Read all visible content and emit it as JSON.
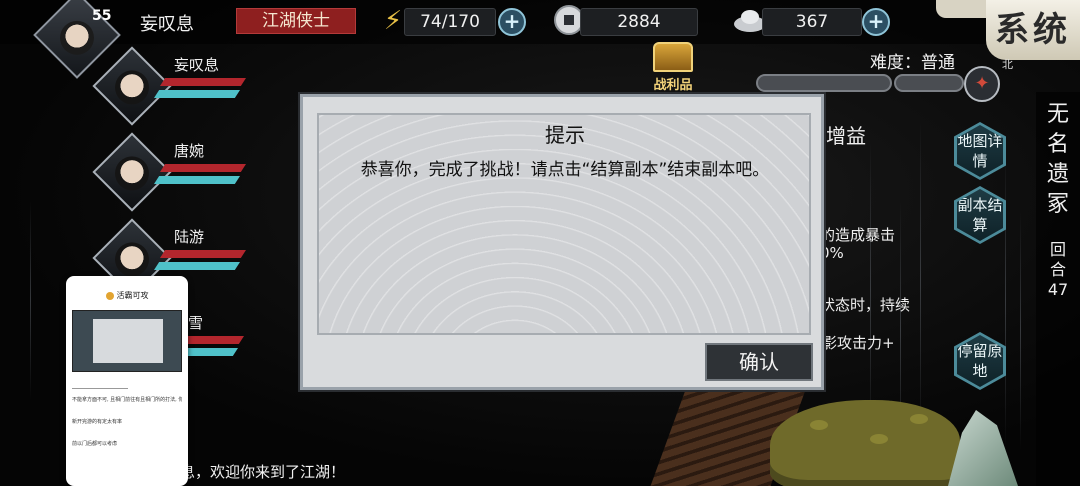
{
  "player": {
    "name": "妄叹息",
    "level": "55",
    "title": "江湖侠士"
  },
  "resources": {
    "stamina": {
      "icon": "lightning-icon",
      "value": "74/170"
    },
    "coins": {
      "icon": "coin-icon",
      "value": "2884"
    },
    "ingots": {
      "icon": "gold-ingot-icon",
      "value": "367"
    },
    "plus_label": "+"
  },
  "system_button": {
    "label": "系统"
  },
  "difficulty": {
    "label": "难度：普通"
  },
  "compass": {
    "north_label": "北"
  },
  "loot": {
    "label": "战利品"
  },
  "party": [
    {
      "name": "妄叹息"
    },
    {
      "name": "唐婉"
    },
    {
      "name": "陆游"
    },
    {
      "name": "雪"
    }
  ],
  "location": {
    "name": "无名遗冢",
    "turn_label": "回合",
    "turn_value": "47"
  },
  "side_buttons": {
    "map_details": "地图详情",
    "instance_settle": "副本结算",
    "stay": "停留原地"
  },
  "buffs_panel": {
    "title": "增益",
    "lines": [
      "的造成暴击",
      "0%",
      "状态时，持续",
      "影攻击力+"
    ]
  },
  "dialog": {
    "title": "提示",
    "message": "恭喜你，完成了挑战！请点击“结算副本”结束副本吧。",
    "confirm_label": "确认"
  },
  "chat": {
    "message": "妄叹息，欢迎你来到了江湖！"
  },
  "floating_card": {
    "header": "活霸可攻",
    "lines": [
      "不能拿方面不可, 且相门前往有且相门所的打法, 你能",
      "新开完游的有定太有率",
      "前以门后都可以考虑"
    ]
  }
}
